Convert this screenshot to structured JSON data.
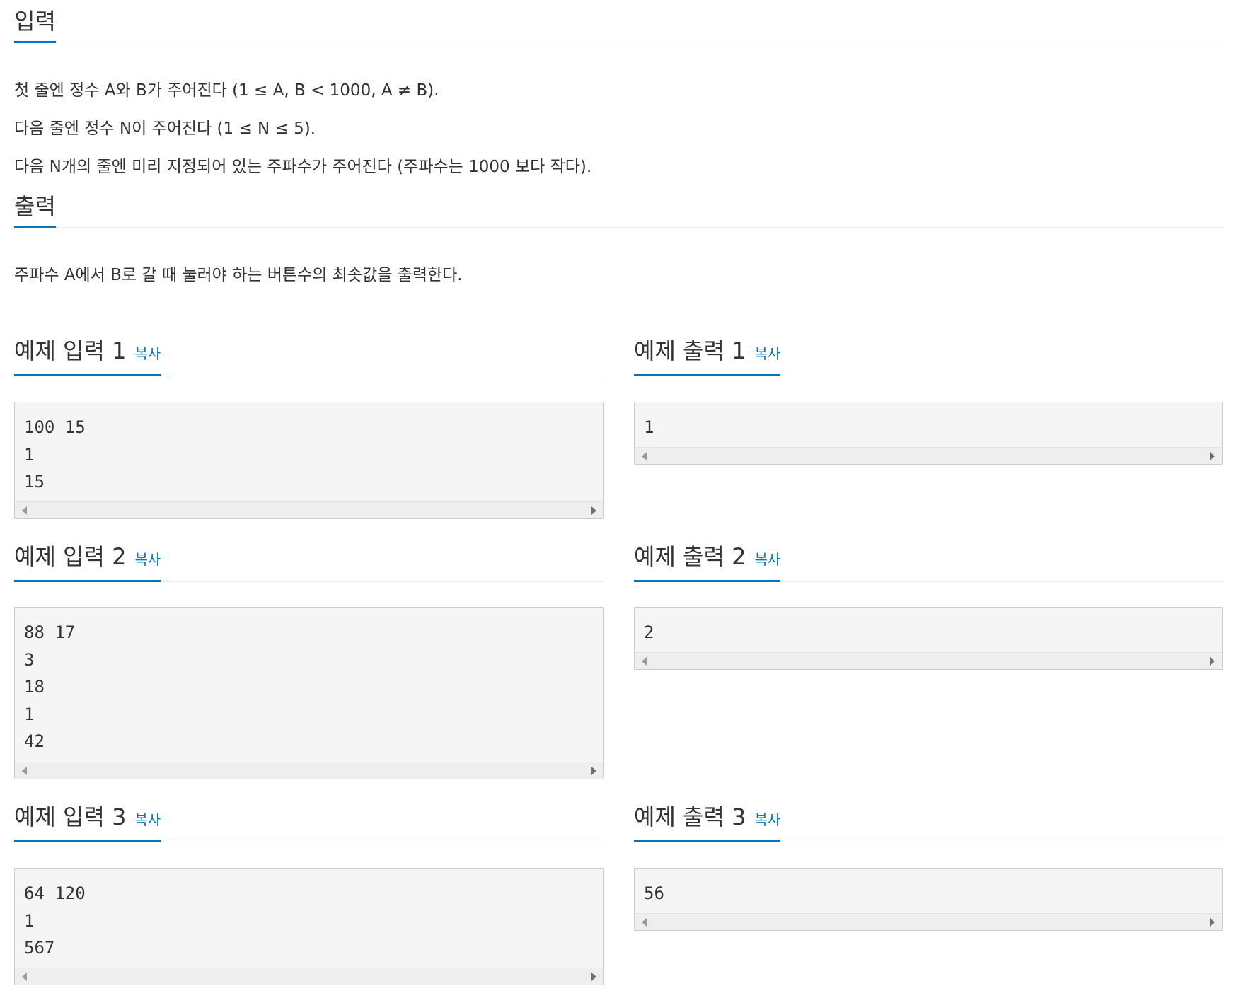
{
  "input_section": {
    "title": "입력",
    "lines": [
      "첫 줄엔 정수 A와 B가 주어진다 (1 ≤ A, B < 1000, A ≠ B).",
      "다음 줄엔 정수 N이 주어진다 (1 ≤ N ≤ 5).",
      "다음 N개의 줄엔 미리 지정되어 있는 주파수가 주어진다 (주파수는 1000 보다 작다)."
    ]
  },
  "output_section": {
    "title": "출력",
    "lines": [
      "주파수 A에서 B로 갈 때 눌러야 하는 버튼수의 최솟값을 출력한다."
    ]
  },
  "copy_label": "복사",
  "samples": [
    {
      "input_title": "예제 입력 1",
      "output_title": "예제 출력 1",
      "input_lines": [
        "100 15",
        "1",
        "15"
      ],
      "output_lines": [
        "1"
      ]
    },
    {
      "input_title": "예제 입력 2",
      "output_title": "예제 출력 2",
      "input_lines": [
        "88 17",
        "3",
        "18",
        "1",
        "42"
      ],
      "output_lines": [
        "2"
      ]
    },
    {
      "input_title": "예제 입력 3",
      "output_title": "예제 출력 3",
      "input_lines": [
        "64 120",
        "1",
        "567"
      ],
      "output_lines": [
        "56"
      ]
    }
  ],
  "colors": {
    "accent": "#0076c0",
    "text": "#333333",
    "code_background": "#f5f5f5"
  }
}
